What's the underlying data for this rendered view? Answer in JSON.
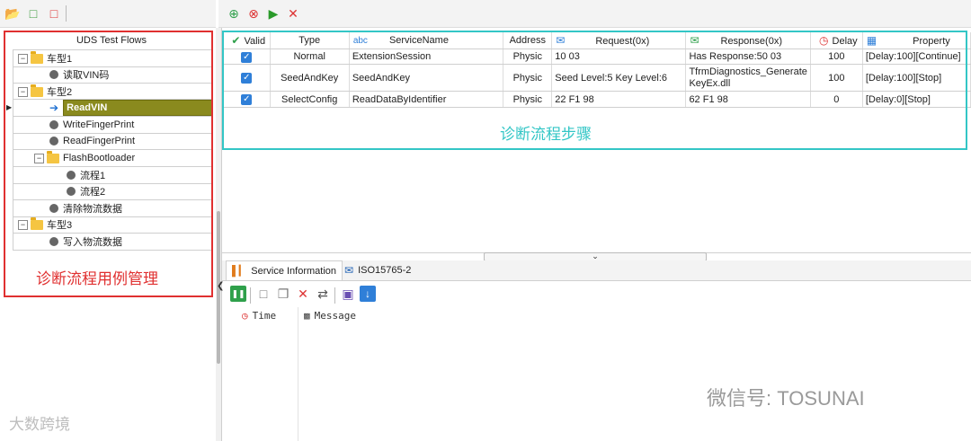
{
  "left_toolbar": {
    "icons": [
      "folder-open-icon",
      "add-file-icon",
      "delete-file-icon"
    ]
  },
  "right_toolbar": {
    "icons": [
      "add-icon",
      "remove-icon",
      "run-icon",
      "close-icon"
    ]
  },
  "tree": {
    "title": "UDS Test Flows",
    "items": [
      {
        "label": "车型1"
      },
      {
        "label": "读取VIN码"
      },
      {
        "label": "车型2"
      },
      {
        "label": "ReadVIN"
      },
      {
        "label": "WriteFingerPrint"
      },
      {
        "label": "ReadFingerPrint"
      },
      {
        "label": "FlashBootloader"
      },
      {
        "label": "流程1"
      },
      {
        "label": "流程2"
      },
      {
        "label": "清除物流数据"
      },
      {
        "label": "车型3"
      },
      {
        "label": "写入物流数据"
      }
    ],
    "caption": "诊断流程用例管理"
  },
  "table": {
    "headers": {
      "valid": "Valid",
      "type": "Type",
      "abc": "abc",
      "service_name": "ServiceName",
      "address": "Address",
      "request": "Request(0x)",
      "response": "Response(0x)",
      "delay": "Delay",
      "property": "Property"
    },
    "rows": [
      {
        "type": "Normal",
        "service_name": "ExtensionSession",
        "address": "Physic",
        "request": "10 03",
        "response": "Has Response:50 03",
        "response2": "",
        "delay": "100",
        "property": "[Delay:100][Continue]"
      },
      {
        "type": "SeedAndKey",
        "service_name": "SeedAndKey",
        "address": "Physic",
        "request": "Seed Level:5 Key Level:6",
        "response": "TfrmDiagnostics_Generate",
        "response2": "KeyEx.dll",
        "delay": "100",
        "property": "[Delay:100][Stop]"
      },
      {
        "type": "SelectConfig",
        "service_name": "ReadDataByIdentifier",
        "address": "Physic",
        "request": "22 F1 98",
        "response": "62 F1 98",
        "response2": "",
        "delay": "0",
        "property": "[Delay:0][Stop]"
      }
    ],
    "caption": "诊断流程步骤"
  },
  "bottom": {
    "tabs": [
      {
        "label": "Service Information"
      },
      {
        "label": "ISO15765-2"
      }
    ],
    "log_columns": {
      "time": "Time",
      "message": "Message"
    }
  },
  "watermarks": {
    "left": "大数跨境",
    "right": "微信号: TOSUNAI"
  },
  "colors": {
    "tree_highlight": "#e03030",
    "table_highlight": "#33c6c6",
    "selected_row": "#8a8a1e",
    "checkbox": "#2f7fd8"
  }
}
